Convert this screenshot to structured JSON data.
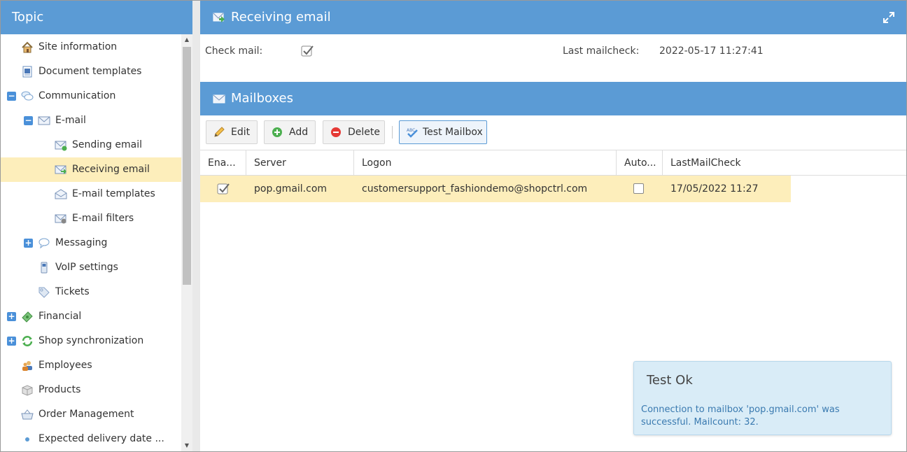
{
  "sidebar": {
    "title": "Topic",
    "items": [
      {
        "label": "Site information",
        "icon": "home-icon"
      },
      {
        "label": "Document templates",
        "icon": "document-icon"
      },
      {
        "label": "Communication",
        "icon": "chat-bubbles-icon",
        "toggle": "−"
      },
      {
        "label": "E-mail",
        "icon": "envelope-icon",
        "toggle": "−"
      },
      {
        "label": "Sending email",
        "icon": "send-mail-icon"
      },
      {
        "label": "Receiving email",
        "icon": "receive-mail-icon"
      },
      {
        "label": "E-mail templates",
        "icon": "mail-template-icon"
      },
      {
        "label": "E-mail filters",
        "icon": "mail-filter-icon"
      },
      {
        "label": "Messaging",
        "icon": "speech-bubble-icon",
        "toggle": "+"
      },
      {
        "label": "VoIP settings",
        "icon": "phone-icon"
      },
      {
        "label": "Tickets",
        "icon": "ticket-icon"
      },
      {
        "label": "Financial",
        "icon": "money-icon",
        "toggle": "+"
      },
      {
        "label": "Shop synchronization",
        "icon": "sync-icon",
        "toggle": "+"
      },
      {
        "label": "Employees",
        "icon": "users-icon"
      },
      {
        "label": "Products",
        "icon": "box-icon"
      },
      {
        "label": "Order Management",
        "icon": "basket-icon"
      },
      {
        "label": "Expected delivery date ...",
        "icon": "bullet-icon"
      }
    ]
  },
  "receiving": {
    "title": "Receiving email",
    "check_mail_label": "Check mail:",
    "last_check_label": "Last mailcheck:",
    "last_check_value": "2022-05-17 11:27:41"
  },
  "mailboxes": {
    "title": "Mailboxes",
    "toolbar": {
      "edit": "Edit",
      "add": "Add",
      "delete": "Delete",
      "test": "Test Mailbox"
    },
    "columns": [
      "Ena...",
      "Server",
      "Logon",
      "Auto...",
      "LastMailCheck"
    ],
    "rows": [
      {
        "enabled": true,
        "server": "pop.gmail.com",
        "logon": "customersupport_fashiondemo@shopctrl.com",
        "auto": false,
        "last_check": "17/05/2022 11:27"
      }
    ]
  },
  "toast": {
    "title": "Test Ok",
    "message": "Connection to mailbox 'pop.gmail.com' was successful. Mailcount: 32."
  },
  "colors": {
    "header_blue": "#5b9bd5",
    "selected_row": "#fdeebb",
    "toast_bg": "#d9ecf7"
  }
}
